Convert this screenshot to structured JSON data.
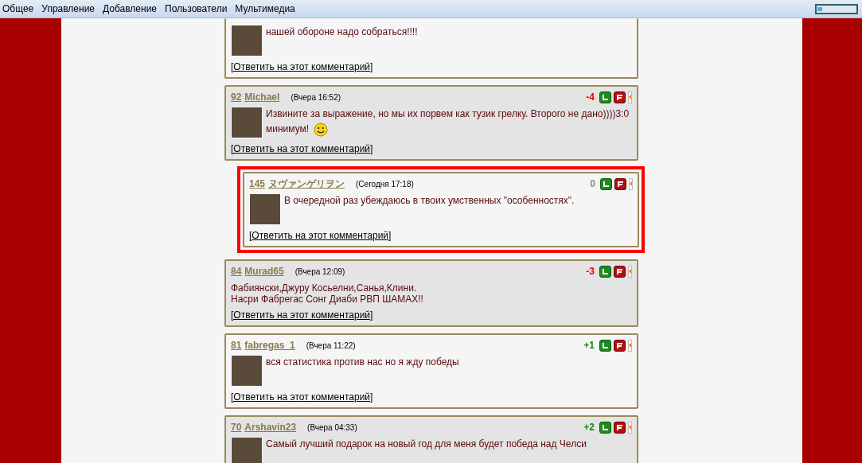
{
  "menu": [
    {
      "label": "Общее"
    },
    {
      "label": "Управление"
    },
    {
      "label": "Добавление"
    },
    {
      "label": "Пользователи"
    },
    {
      "label": "Мультимедиа"
    }
  ],
  "zoom_slider": {
    "level": 0.12
  },
  "comments": [
    {
      "partial": true,
      "shaded": false,
      "highlighted": false,
      "avatar": true,
      "emoticon": false,
      "lines": [
        "нашей обороне надо собраться!!!!"
      ],
      "reply_link": "[Ответить на этот комментарий]"
    },
    {
      "partial": false,
      "shaded": true,
      "highlighted": false,
      "number": "92",
      "author": "Michael",
      "time": "(Вчера 16:52)",
      "score": "-4",
      "color": "#ee0000",
      "avatar": true,
      "emoticon": true,
      "lines": [
        "Извините за выражение, но мы их порвем как тузик грелку. Второго не дано))))3:0 минимум!"
      ],
      "reply_link": "[Ответить на этот комментарий]",
      "children": [
        {
          "partial": false,
          "shaded": false,
          "highlighted": true,
          "number": "145",
          "author": "ヌヴァンゲリヲン",
          "time": "(Сегодня 17:18)",
          "score": "0",
          "color": "#8a8a8a",
          "avatar": true,
          "emoticon": false,
          "lines": [
            "В очередной раз убеждаюсь в твоих умственных \"особенностях\"."
          ],
          "reply_link": "[Ответить на этот комментарий]"
        }
      ]
    },
    {
      "partial": false,
      "shaded": true,
      "highlighted": false,
      "number": "84",
      "author": "Murad65",
      "time": "(Вчера 12:09)",
      "score": "-3",
      "color": "#ee0000",
      "avatar": false,
      "emoticon": false,
      "lines": [
        "Фабиянски,Джуру Косьелни,Санья,Клини.",
        "Насри Фабрегас Сонг Диаби РВП ШАМАХ!!"
      ],
      "reply_link": "[Ответить на этот комментарий]"
    },
    {
      "partial": false,
      "shaded": false,
      "highlighted": false,
      "number": "81",
      "author": "fabregas_1",
      "time": "(Вчера 11:22)",
      "score": "+1",
      "color": "#118811",
      "avatar": true,
      "emoticon": false,
      "lines": [
        "вся статистика против нас но я жду победы"
      ],
      "reply_link": "[Ответить на этот комментарий]"
    },
    {
      "partial": false,
      "shaded": true,
      "highlighted": false,
      "number": "70",
      "author": "Arshavin23",
      "time": "(Вчера 04:33)",
      "score": "+2",
      "color": "#118811",
      "avatar": true,
      "emoticon": false,
      "lines": [
        "Самый лучший подарок на новый год для меня будет победа над Челси"
      ]
    }
  ]
}
